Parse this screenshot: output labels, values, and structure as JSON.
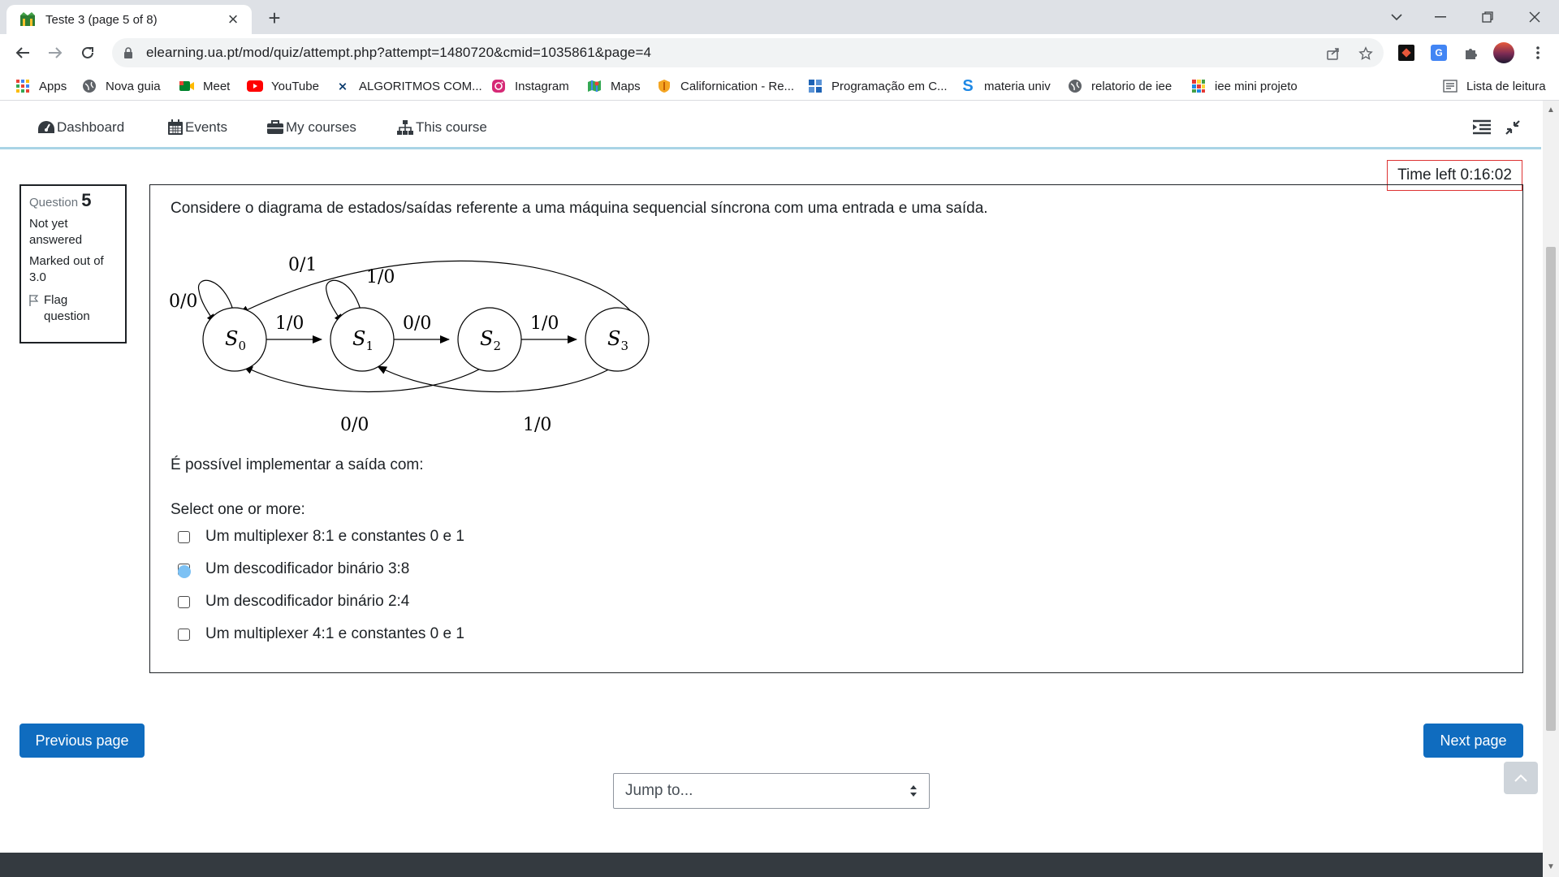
{
  "browser": {
    "tab_title": "Teste 3 (page 5 of 8)",
    "url": "elearning.ua.pt/mod/quiz/attempt.php?attempt=1480720&cmid=1035861&page=4",
    "bookmarks": [
      {
        "label": "Apps",
        "icon": "apps-grid-icon"
      },
      {
        "label": "Nova guia",
        "icon": "globe-icon"
      },
      {
        "label": "Meet",
        "icon": "meet-icon"
      },
      {
        "label": "YouTube",
        "icon": "youtube-icon"
      },
      {
        "label": "ALGORITMOS COM...",
        "icon": "algoritmos-icon"
      },
      {
        "label": "Instagram",
        "icon": "instagram-icon"
      },
      {
        "label": "Maps",
        "icon": "maps-icon"
      },
      {
        "label": "Californication - Re...",
        "icon": "shield-icon"
      },
      {
        "label": "Programação em C...",
        "icon": "site-icon"
      },
      {
        "label": "materia univ",
        "icon": "s-icon"
      },
      {
        "label": "relatorio de iee",
        "icon": "globe-icon"
      },
      {
        "label": "iee mini projeto",
        "icon": "grid-icon"
      }
    ],
    "reading_list": "Lista de leitura"
  },
  "navbar": {
    "items": [
      {
        "label": "Dashboard",
        "icon": "dashboard-icon"
      },
      {
        "label": "Events",
        "icon": "calendar-icon"
      },
      {
        "label": "My courses",
        "icon": "briefcase-icon"
      },
      {
        "label": "This course",
        "icon": "sitemap-icon"
      }
    ]
  },
  "timer": {
    "text": "Time left 0:16:02"
  },
  "question_info": {
    "label": "Question",
    "number": "5",
    "status": "Not yet answered",
    "marks": "Marked out of 3.0",
    "flag_label": "Flag question"
  },
  "question": {
    "text": "Considere o diagrama de estados/saídas referente a uma máquina sequencial síncrona com uma entrada e uma saída.",
    "diagram": {
      "states": [
        {
          "name": "S",
          "sub": "0"
        },
        {
          "name": "S",
          "sub": "1"
        },
        {
          "name": "S",
          "sub": "2"
        },
        {
          "name": "S",
          "sub": "3"
        }
      ],
      "labels": {
        "s0_self": "0/0",
        "s1_self": "1/0",
        "s0_s1": "1/0",
        "s1_s2": "0/0",
        "s2_s3": "1/0",
        "s3_s0": "0/1",
        "s2_s0": "0/0",
        "s3_s1": "1/0"
      }
    },
    "prompt": "É possível implementar a saída com:",
    "select_label": "Select one or more:",
    "options": [
      {
        "label": "Um multiplexer 8:1 e constantes 0 e 1",
        "checked": false
      },
      {
        "label": "Um descodificador binário 3:8",
        "checked": false
      },
      {
        "label": "Um descodificador binário 2:4",
        "checked": false
      },
      {
        "label": "Um multiplexer 4:1 e constantes 0 e 1",
        "checked": false
      }
    ]
  },
  "navigation": {
    "previous": "Previous page",
    "next": "Next page",
    "jump": "Jump to..."
  },
  "colors": {
    "primary": "#0f6cbf",
    "timer_border": "#dd3333",
    "nav_underline": "#a9d4e6"
  }
}
